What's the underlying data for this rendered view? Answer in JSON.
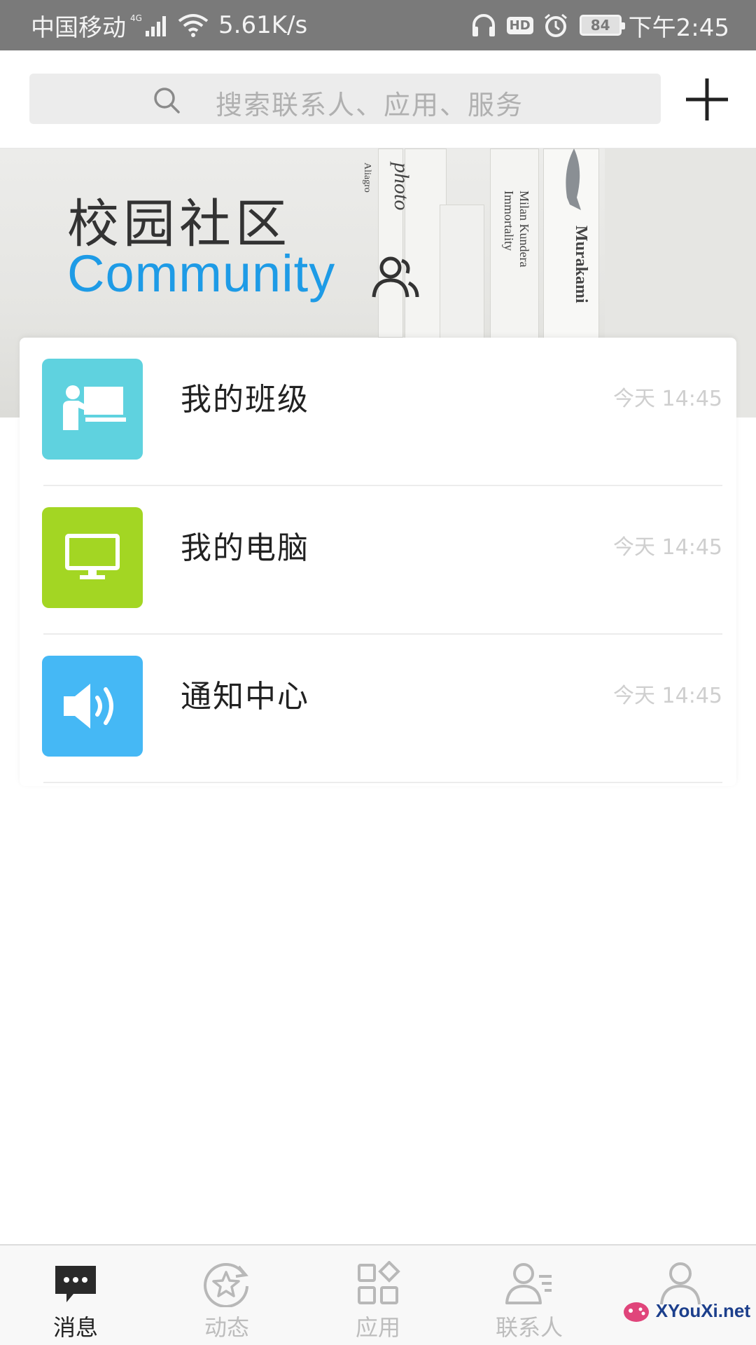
{
  "status_bar": {
    "carrier": "中国移动",
    "network": "4G",
    "speed": "5.61K/s",
    "hd": "HD",
    "battery": "84",
    "time": "下午2:45"
  },
  "header": {
    "search_placeholder": "搜索联系人、应用、服务",
    "add_icon": "plus-icon"
  },
  "banner": {
    "title_cn": "校园社区",
    "title_en": "Community",
    "book_texts": [
      "photo",
      "Milan Kundera",
      "Immortality",
      "Murakami",
      "Aliagro"
    ]
  },
  "list": [
    {
      "title": "我的班级",
      "time": "今天 14:45",
      "icon": "teacher-board-icon",
      "color": "#5fd2df"
    },
    {
      "title": "我的电脑",
      "time": "今天 14:45",
      "icon": "monitor-icon",
      "color": "#a3d623"
    },
    {
      "title": "通知中心",
      "time": "今天 14:45",
      "icon": "speaker-icon",
      "color": "#45b8f5"
    }
  ],
  "bottom_nav": [
    {
      "label": "消息",
      "icon": "chat-bubble-icon",
      "active": true
    },
    {
      "label": "动态",
      "icon": "star-refresh-icon",
      "active": false
    },
    {
      "label": "应用",
      "icon": "apps-grid-icon",
      "active": false
    },
    {
      "label": "联系人",
      "icon": "contacts-icon",
      "active": false
    },
    {
      "label": "",
      "icon": "profile-icon",
      "active": false
    }
  ],
  "watermark": "XYouXi.net",
  "colors": {
    "accent_blue": "#1e9be6",
    "status_bar_bg": "#7a7a7a"
  }
}
